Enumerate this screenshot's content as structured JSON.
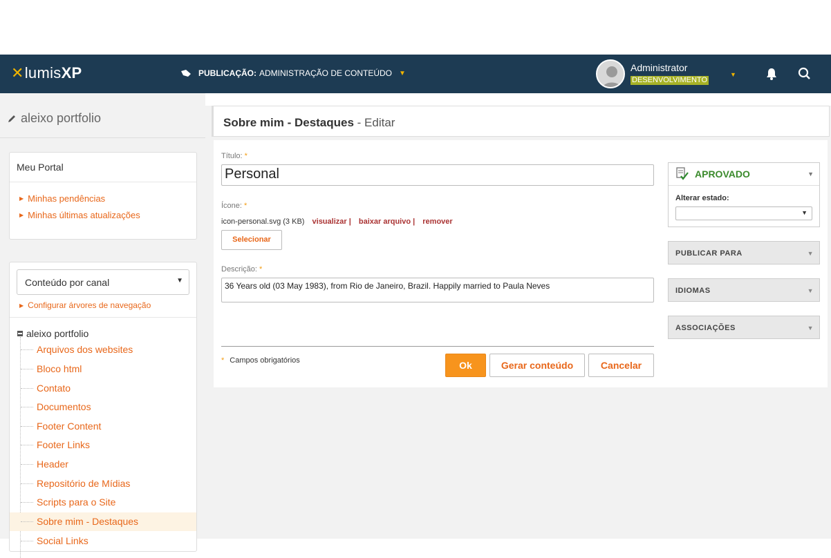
{
  "topbar": {
    "logo_light": "lumis",
    "logo_bold": "XP",
    "publication_prefix": "PUBLICAÇÃO:",
    "publication_name": "ADMINISTRAÇÃO DE CONTEÚDO",
    "user_name": "Administrator",
    "environment": "DESENVOLVIMENTO",
    "accent_color": "#f0b400",
    "bar_color": "#1d3b53"
  },
  "sidebar": {
    "title": "aleixo portfolio",
    "portal": {
      "title": "Meu Portal",
      "links": [
        "Minhas pendências",
        "Minhas últimas atualizações"
      ]
    },
    "channel_select": "Conteúdo por canal",
    "config_link": "Configurar árvores de navegação",
    "tree_root": "aleixo portfolio",
    "tree_items": [
      "Arquivos dos websites",
      "Bloco html",
      "Contato",
      "Documentos",
      "Footer Content",
      "Footer Links",
      "Header",
      "Repositório de Mídias",
      "Scripts para o Site",
      "Sobre mim - Destaques",
      "Social Links"
    ],
    "active_item": "Sobre mim - Destaques"
  },
  "editor": {
    "title_bold": "Sobre mim - Destaques",
    "title_suffix": " - Editar",
    "title_label": "Título:",
    "title_value": "Personal",
    "icon_label": "Ícone:",
    "file_info": "icon-personal.svg (3 KB)",
    "file_links": [
      "visualizar |",
      "baixar arquivo |",
      "remover"
    ],
    "select_button": "Selecionar",
    "desc_label": "Descrição:",
    "desc_value": "36 Years old (03 May 1983), from Rio de Janeiro, Brazil. Happily married to Paula Neves",
    "required_note": "Campos obrigatórios",
    "required_mark": "*",
    "ok_button": "Ok",
    "generate_button": "Gerar conteúdo",
    "cancel_button": "Cancelar"
  },
  "right_panel": {
    "status": "APROVADO",
    "change_state_label": "Alterar estado:",
    "change_state_value": "",
    "sections": [
      "PUBLICAR PARA",
      "IDIOMAS",
      "ASSOCIAÇÕES"
    ]
  }
}
